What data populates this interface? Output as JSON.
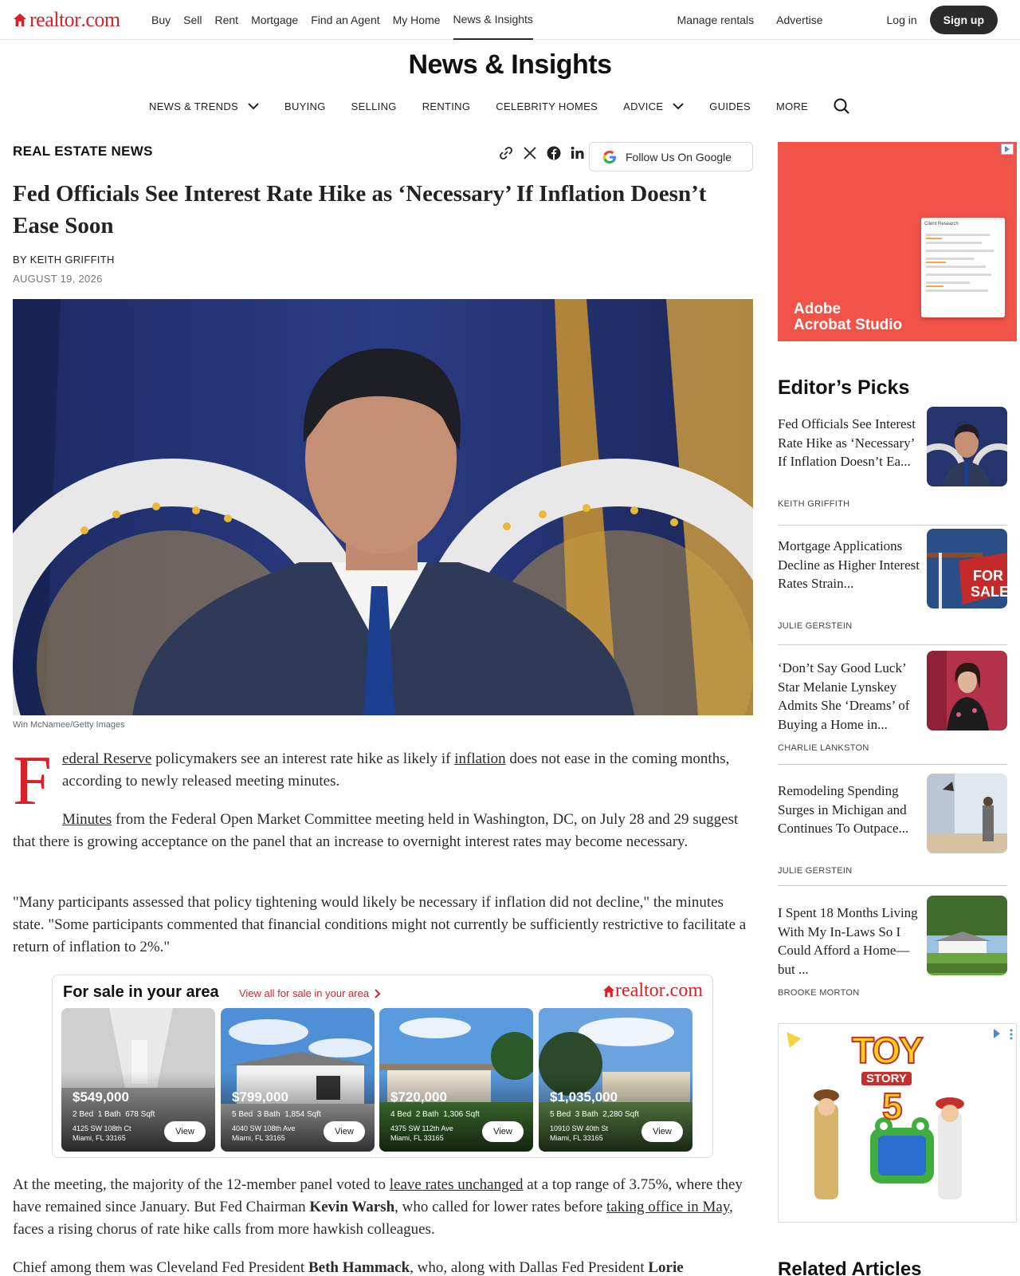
{
  "brand": {
    "logo_main": "realtor",
    "logo_suffix": ".com"
  },
  "top_nav": [
    "Buy",
    "Sell",
    "Rent",
    "Mortgage",
    "Find an Agent",
    "My Home",
    "News & Insights"
  ],
  "top_right": {
    "manage": "Manage rentals",
    "advertise": "Advertise",
    "login": "Log in",
    "signup": "Sign up"
  },
  "section_title": "News & Insights",
  "section_nav": [
    "NEWS & TRENDS",
    "BUYING",
    "SELLING",
    "RENTING",
    "CELEBRITY HOMES",
    "ADVICE",
    "GUIDES",
    "MORE"
  ],
  "article": {
    "category": "REAL ESTATE NEWS",
    "follow_google": "Follow Us On Google",
    "headline": "Fed Officials See Interest Rate Hike as ‘Necessary’ If Inflation Doesn’t Ease Soon",
    "byline": "BY KEITH GRIFFITH",
    "date": "AUGUST 19, 2026",
    "caption": "Win McNamee/Getty Images",
    "dropcap": "F",
    "p1": {
      "a": "ederal Reserve",
      "b": " policymakers see an interest rate hike as likely if ",
      "c": "inflation",
      "d": " does not ease in the coming months, according to newly released meeting minutes."
    },
    "p2": {
      "a": "Minutes",
      "b": " from the Federal Open Market Committee meeting held in Washington, DC, on July 28 and 29 suggest that there is growing acceptance on the panel that an increase to overnight interest rates may become necessary."
    },
    "p3": "\"Many participants assessed that policy tightening would likely be necessary if inflation did not decline,\" the minutes state. \"Some participants commented that financial conditions might not currently be sufficiently restrictive to facilitate a return of inflation to 2%.\"",
    "p4": {
      "a": "At the meeting, the majority of the 12-member panel voted to ",
      "b": "leave rates unchanged",
      "c": " at a top range of 3.75%, where they have remained since January. But Fed Chairman ",
      "d": "Kevin Warsh",
      "e": ", who called for lower rates before ",
      "f": "taking office in May",
      "g": ", faces a rising chorus of rate hike calls from more hawkish colleagues."
    },
    "p5": {
      "a": "Chief among them was Cleveland Fed President ",
      "b": "Beth Hammack",
      "c": ", who, along with Dallas Fed President ",
      "d": "Lorie"
    }
  },
  "for_sale": {
    "title": "For sale in your area",
    "view_all": "View all for sale in your area",
    "view_label": "View",
    "listings": [
      {
        "price": "$549,000",
        "beds": "2 Bed",
        "baths": "1 Bath",
        "sqft": "678 Sqft",
        "addr1": "4125 SW 108th Ct",
        "addr2": "Miami, FL 33165"
      },
      {
        "price": "$799,000",
        "beds": "5 Bed",
        "baths": "3 Bath",
        "sqft": "1,854 Sqft",
        "addr1": "4040 SW 108th Ave",
        "addr2": "Miami, FL 33165"
      },
      {
        "price": "$720,000",
        "beds": "4 Bed",
        "baths": "2 Bath",
        "sqft": "1,306 Sqft",
        "addr1": "4375 SW 112th Ave",
        "addr2": "Miami, FL 33165"
      },
      {
        "price": "$1,035,000",
        "beds": "5 Bed",
        "baths": "3 Bath",
        "sqft": "2,280 Sqft",
        "addr1": "10910 SW 40th St",
        "addr2": "Miami, FL 33165"
      }
    ]
  },
  "ad1": {
    "brand_line1": "Adobe",
    "brand_line2": "Acrobat Studio",
    "doc_title": "Client Research"
  },
  "editors_picks": {
    "heading": "Editor’s Picks",
    "items": [
      {
        "title": "Fed Officials See Interest Rate Hike as ‘Necessary’ If Inflation Doesn’t Ea...",
        "author": "KEITH GRIFFITH"
      },
      {
        "title": "Mortgage Applications Decline as Higher Interest Rates Strain...",
        "author": "JULIE GERSTEIN"
      },
      {
        "title": "‘Don’t Say Good Luck’ Star Melanie Lynskey Admits She ‘Dreams’ of Buying a Home in...",
        "author": "CHARLIE LANKSTON"
      },
      {
        "title": "Remodeling Spending Surges in Michigan and Continues To Outpace...",
        "author": "JULIE GERSTEIN"
      },
      {
        "title": "I Spent 18 Months Living With My In-Laws So I Could Afford a Home—but ...",
        "author": "BROOKE MORTON"
      }
    ]
  },
  "ad2": {
    "line1": "TOY",
    "line2": "STORY",
    "line3": "5"
  },
  "related_heading": "Related Articles",
  "colors": {
    "brand_red": "#d92228",
    "dark": "#2b2b2b",
    "ad_red": "#f05449"
  }
}
